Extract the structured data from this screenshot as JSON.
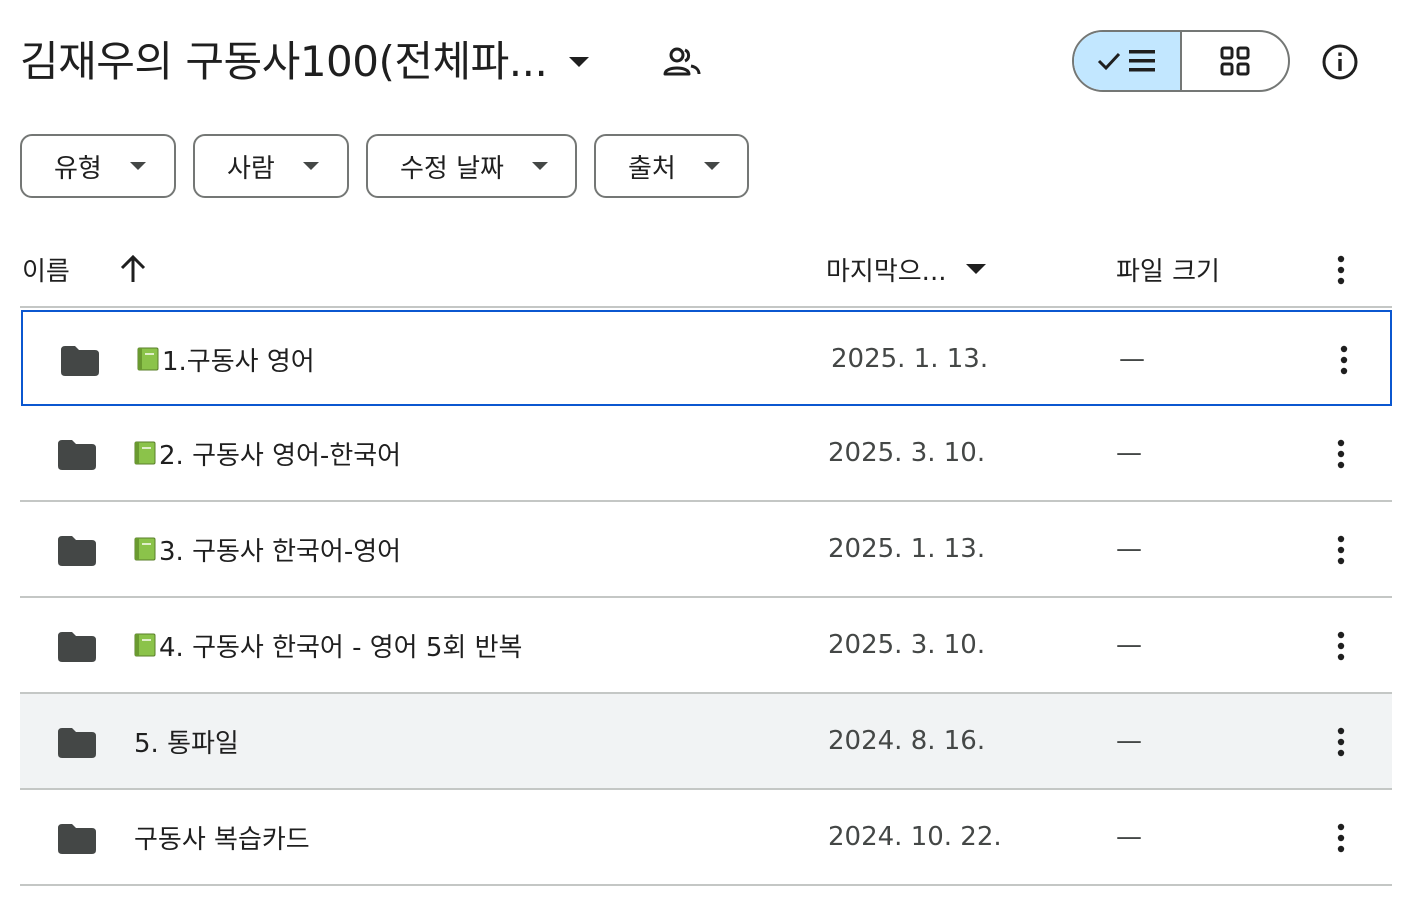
{
  "header": {
    "title": "김재우의 구동사100(전체파...",
    "shared_icon": "people-icon",
    "view_list_icon": "check-list-icon",
    "view_grid_icon": "grid-icon",
    "info_icon": "info-icon"
  },
  "filters": [
    {
      "label": "유형"
    },
    {
      "label": "사람"
    },
    {
      "label": "수정 날짜"
    },
    {
      "label": "출처"
    }
  ],
  "table": {
    "col_name": "이름",
    "col_modified": "마지막으...",
    "col_size": "파일 크기"
  },
  "rows": [
    {
      "name": "1.구동사 영어",
      "has_book_icon": true,
      "date": "2025. 1. 13.",
      "size": "—",
      "state": "selected"
    },
    {
      "name": "2. 구동사 영어-한국어",
      "has_book_icon": true,
      "date": "2025. 3. 10.",
      "size": "—",
      "state": "normal"
    },
    {
      "name": "3. 구동사 한국어-영어",
      "has_book_icon": true,
      "date": "2025. 1. 13.",
      "size": "—",
      "state": "normal"
    },
    {
      "name": "4. 구동사 한국어 - 영어 5회 반복",
      "has_book_icon": true,
      "date": "2025. 3. 10.",
      "size": "—",
      "state": "normal"
    },
    {
      "name": "5. 통파일",
      "has_book_icon": false,
      "date": "2024. 8. 16.",
      "size": "—",
      "state": "hover"
    },
    {
      "name": "구동사 복습카드",
      "has_book_icon": false,
      "date": "2024. 10. 22.",
      "size": "—",
      "state": "normal"
    }
  ],
  "colors": {
    "selected_border": "#0b57d0",
    "toggle_active_bg": "#c2e7ff",
    "hover_row_bg": "#f1f3f4",
    "folder_icon": "#444746",
    "book_icon": "#8bc34a"
  }
}
